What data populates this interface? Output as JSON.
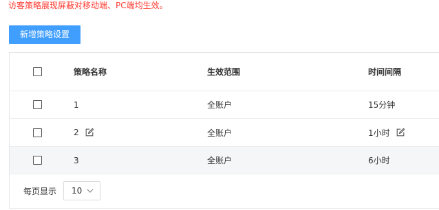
{
  "notice": "访客策略展现屏蔽对移动端、PC端均生效。",
  "toolbar": {
    "add_label": "新增策略设置"
  },
  "table": {
    "columns": {
      "name": "策略名称",
      "scope": "生效范围",
      "interval": "时间间隔"
    },
    "rows": [
      {
        "name": "1",
        "scope": "全账户",
        "interval": "15分钟",
        "name_editable": false,
        "interval_editable": false
      },
      {
        "name": "2",
        "scope": "全账户",
        "interval": "1小时",
        "name_editable": true,
        "interval_editable": true
      },
      {
        "name": "3",
        "scope": "全账户",
        "interval": "6小时",
        "name_editable": false,
        "interval_editable": false
      }
    ]
  },
  "pagination": {
    "per_page_label": "每页显示",
    "page_size": "10"
  },
  "colors": {
    "notice": "#ff3b30",
    "primary_button": "#409eff",
    "hover_row": "#f5f6f7"
  },
  "icons": {
    "edit": "edit-icon",
    "dropdown": "chevron-down-icon"
  }
}
